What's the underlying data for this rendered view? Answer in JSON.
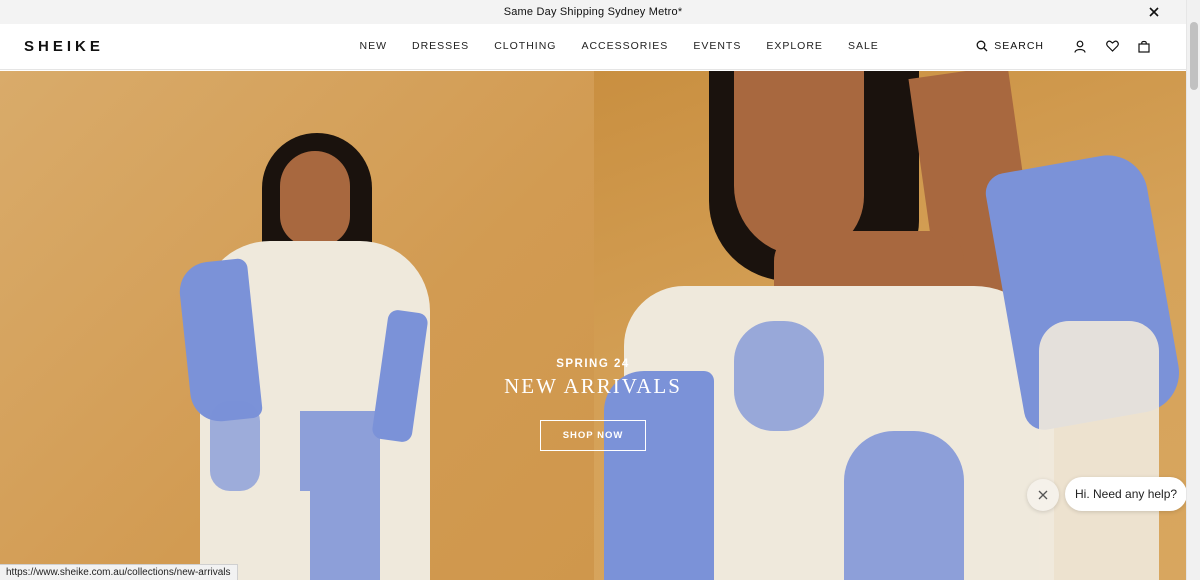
{
  "announcement": {
    "text": "Same Day Shipping Sydney Metro*",
    "close_icon": "close-icon"
  },
  "header": {
    "logo": "SHEIKE",
    "nav": [
      "NEW",
      "DRESSES",
      "CLOTHING",
      "ACCESSORIES",
      "EVENTS",
      "EXPLORE",
      "SALE"
    ],
    "search_label": "SEARCH",
    "icons": [
      "search-icon",
      "account-icon",
      "wishlist-icon",
      "bag-icon"
    ]
  },
  "hero": {
    "eyebrow": "SPRING 24",
    "headline": "NEW ARRIVALS",
    "cta_label": "SHOP NOW"
  },
  "chat": {
    "prompt": "Hi. Need any help?"
  },
  "status_bar": {
    "url": "https://www.sheike.com.au/collections/new-arrivals"
  },
  "colors": {
    "hero_bg": "#d6a35a",
    "print_blue": "#7b92d8",
    "text": "#111111"
  }
}
